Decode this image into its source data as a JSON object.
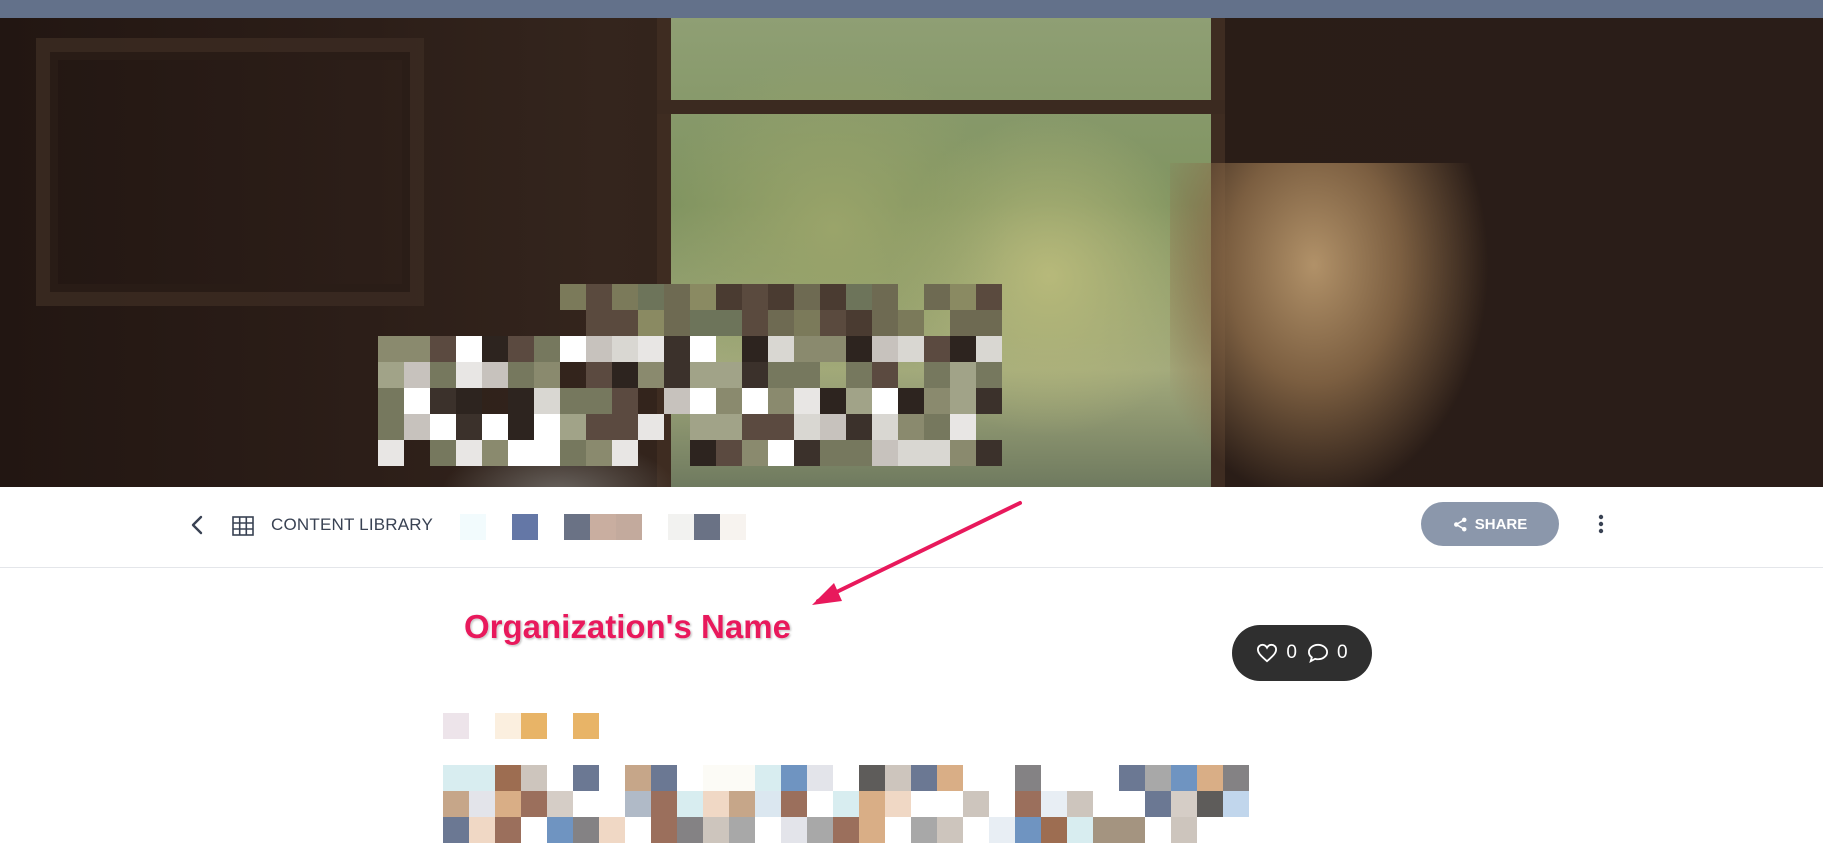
{
  "toolbar": {
    "section_label": "CONTENT LIBRARY",
    "share_label": "SHARE"
  },
  "annotation": {
    "label": "Organization's Name"
  },
  "stats": {
    "likes": "0",
    "comments": "0"
  },
  "colors": {
    "topbar": "#63718a",
    "share_button": "#8b97ab",
    "annotation": "#e8195c",
    "stats_pill": "#2f2f2f"
  },
  "icons": {
    "back": "chevron-left-icon",
    "grid": "grid-icon",
    "share": "share-icon",
    "more": "more-vertical-icon",
    "like": "heart-icon",
    "comment": "comment-icon"
  }
}
